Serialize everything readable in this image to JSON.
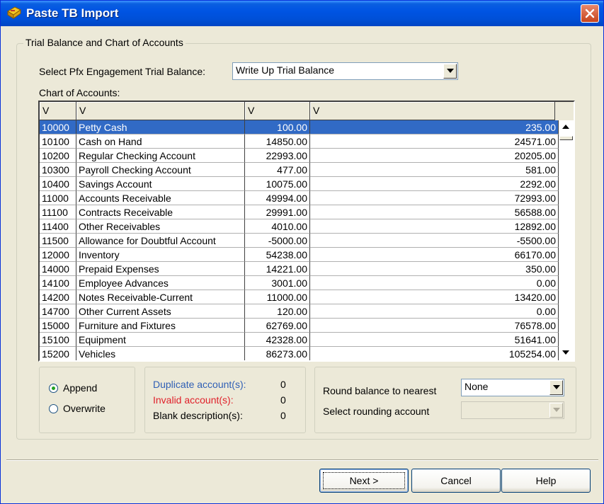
{
  "window": {
    "title": "Paste TB Import"
  },
  "group": {
    "legend": "Trial Balance and Chart of Accounts"
  },
  "engagement": {
    "label": "Select Pfx Engagement Trial Balance:",
    "selected": "Write Up Trial Balance"
  },
  "coa": {
    "label": "Chart of Accounts:"
  },
  "grid": {
    "headers": [
      "V",
      "V",
      "V",
      "V"
    ],
    "rows": [
      {
        "num": "10000",
        "desc": "Petty Cash",
        "a": "100.00",
        "b": "235.00"
      },
      {
        "num": "10100",
        "desc": "Cash on Hand",
        "a": "14850.00",
        "b": "24571.00"
      },
      {
        "num": "10200",
        "desc": "Regular Checking Account",
        "a": "22993.00",
        "b": "20205.00"
      },
      {
        "num": "10300",
        "desc": "Payroll Checking Account",
        "a": "477.00",
        "b": "581.00"
      },
      {
        "num": "10400",
        "desc": "Savings Account",
        "a": "10075.00",
        "b": "2292.00"
      },
      {
        "num": "11000",
        "desc": "Accounts Receivable",
        "a": "49994.00",
        "b": "72993.00"
      },
      {
        "num": "11100",
        "desc": "Contracts Receivable",
        "a": "29991.00",
        "b": "56588.00"
      },
      {
        "num": "11400",
        "desc": "Other Receivables",
        "a": "4010.00",
        "b": "12892.00"
      },
      {
        "num": "11500",
        "desc": "Allowance for Doubtful Account",
        "a": "-5000.00",
        "b": "-5500.00"
      },
      {
        "num": "12000",
        "desc": "Inventory",
        "a": "54238.00",
        "b": "66170.00"
      },
      {
        "num": "14000",
        "desc": "Prepaid Expenses",
        "a": "14221.00",
        "b": "350.00"
      },
      {
        "num": "14100",
        "desc": "Employee Advances",
        "a": "3001.00",
        "b": "0.00"
      },
      {
        "num": "14200",
        "desc": "Notes Receivable-Current",
        "a": "11000.00",
        "b": "13420.00"
      },
      {
        "num": "14700",
        "desc": "Other Current Assets",
        "a": "120.00",
        "b": "0.00"
      },
      {
        "num": "15000",
        "desc": "Furniture and Fixtures",
        "a": "62769.00",
        "b": "76578.00"
      },
      {
        "num": "15100",
        "desc": "Equipment",
        "a": "42328.00",
        "b": "51641.00"
      },
      {
        "num": "15200",
        "desc": "Vehicles",
        "a": "86273.00",
        "b": "105254.00"
      }
    ]
  },
  "mode": {
    "append": "Append",
    "overwrite": "Overwrite",
    "selected": "append"
  },
  "stats": {
    "duplicate_label": "Duplicate account(s):",
    "duplicate_value": "0",
    "duplicate_color": "#2f5fb5",
    "invalid_label": "Invalid account(s):",
    "invalid_value": "0",
    "invalid_color": "#e0202a",
    "blank_label": "Blank description(s):",
    "blank_value": "0"
  },
  "rounding": {
    "round_label": "Round balance to nearest",
    "round_value": "None",
    "account_label": "Select rounding account",
    "account_value": ""
  },
  "buttons": {
    "next": "Next >",
    "cancel": "Cancel",
    "help": "Help"
  }
}
